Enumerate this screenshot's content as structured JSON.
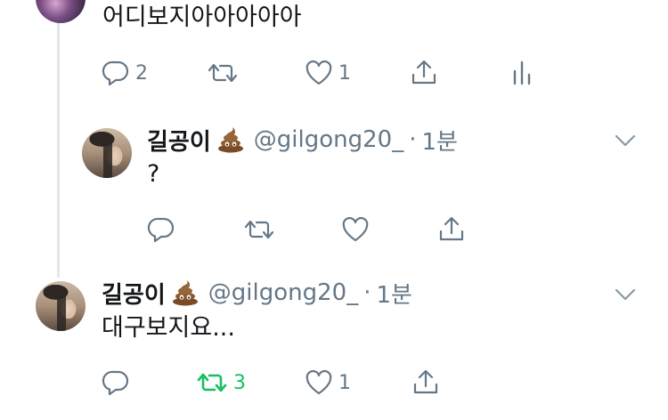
{
  "tweets": [
    {
      "body": "어디보지아아아아아",
      "actions": {
        "reply_count": "2",
        "retweet_count": "",
        "like_count": "1"
      }
    },
    {
      "display_name": "길공이",
      "handle": "@gilgong20_",
      "separator": "·",
      "time": "1분",
      "body": "?",
      "actions": {
        "reply_count": "",
        "retweet_count": "",
        "like_count": ""
      }
    },
    {
      "display_name": "길공이",
      "handle": "@gilgong20_",
      "separator": "·",
      "time": "1분",
      "body": "대구보지요...",
      "actions": {
        "reply_count": "",
        "retweet_count": "3",
        "like_count": "1"
      }
    }
  ],
  "colors": {
    "text": "#14171a",
    "secondary": "#657786",
    "retweet_active": "#17bf63",
    "thread_line": "#e1e8ed"
  },
  "icons": [
    "reply-icon",
    "retweet-icon",
    "like-icon",
    "share-icon",
    "analytics-icon",
    "chevron-down-icon",
    "poop-emoji"
  ]
}
